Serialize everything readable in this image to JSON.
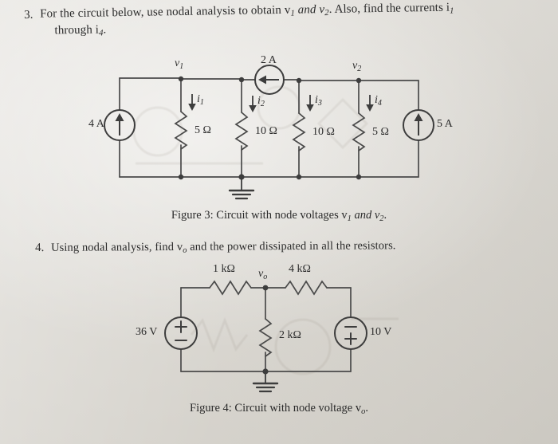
{
  "page": {
    "background_color": "#d9d6cf",
    "ink_color": "#3a3a3a"
  },
  "problem3": {
    "number": "3.",
    "line1": "For the circuit below, use nodal analysis to obtain v",
    "line1_sub1": "1",
    "line1_mid": " and v",
    "line1_sub2": "2",
    "line1_end": ".  Also, find the currents i",
    "line1_sub3": "1",
    "line2_pre": "through i",
    "line2_sub": "4",
    "line2_end": "."
  },
  "problem4": {
    "number": "4.",
    "text_pre": "Using nodal analysis, find v",
    "text_sub": "o",
    "text_post": " and the power dissipated in all the resistors."
  },
  "figure3": {
    "caption_pre": "Figure 3: Circuit with node voltages v",
    "caption_sub1": "1",
    "caption_mid": " and v",
    "caption_sub2": "2",
    "caption_end": ".",
    "nodes": [
      {
        "name": "v1",
        "label": "v",
        "sub": "1"
      },
      {
        "name": "v2",
        "label": "v",
        "sub": "2"
      }
    ],
    "sources": [
      {
        "name": "left-current-source",
        "value": "4 A",
        "type": "current",
        "direction": "up"
      },
      {
        "name": "top-current-source",
        "value": "2 A",
        "type": "current",
        "direction": "left"
      },
      {
        "name": "right-current-source",
        "value": "5 A",
        "type": "current",
        "direction": "up"
      }
    ],
    "resistors": [
      {
        "name": "r1",
        "value": "5 Ω"
      },
      {
        "name": "r2",
        "value": "10 Ω"
      },
      {
        "name": "r3",
        "value": "10 Ω"
      },
      {
        "name": "r4",
        "value": "5 Ω"
      }
    ],
    "currents": [
      {
        "name": "i1",
        "label": "i",
        "sub": "1"
      },
      {
        "name": "i2",
        "label": "i",
        "sub": "2"
      },
      {
        "name": "i3",
        "label": "i",
        "sub": "3"
      },
      {
        "name": "i4",
        "label": "i",
        "sub": "4"
      }
    ],
    "ground": "ground-symbol"
  },
  "figure4": {
    "caption_pre": "Figure 4: Circuit with node voltage v",
    "caption_sub": "o",
    "caption_end": ".",
    "nodes": [
      {
        "name": "vo",
        "label": "v",
        "sub": "o"
      }
    ],
    "sources": [
      {
        "name": "left-voltage-source",
        "value": "36 V",
        "type": "voltage",
        "top_sign": "+",
        "bottom_sign": "−"
      },
      {
        "name": "right-voltage-source",
        "value": "10 V",
        "type": "voltage",
        "top_sign": "−",
        "bottom_sign": "+"
      }
    ],
    "resistors": [
      {
        "name": "r1k",
        "value": "1 kΩ"
      },
      {
        "name": "r4k",
        "value": "4 kΩ"
      },
      {
        "name": "r2k",
        "value": "2 kΩ"
      }
    ],
    "ground": "ground-symbol"
  }
}
